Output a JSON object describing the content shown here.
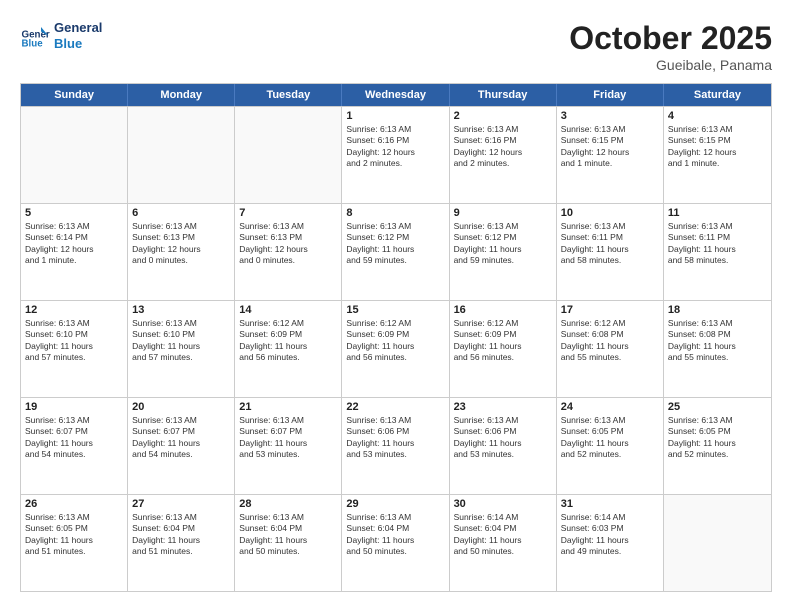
{
  "header": {
    "logo_general": "General",
    "logo_blue": "Blue",
    "month_title": "October 2025",
    "location": "Gueibale, Panama"
  },
  "weekdays": [
    "Sunday",
    "Monday",
    "Tuesday",
    "Wednesday",
    "Thursday",
    "Friday",
    "Saturday"
  ],
  "rows": [
    [
      {
        "day": "",
        "info": ""
      },
      {
        "day": "",
        "info": ""
      },
      {
        "day": "",
        "info": ""
      },
      {
        "day": "1",
        "info": "Sunrise: 6:13 AM\nSunset: 6:16 PM\nDaylight: 12 hours\nand 2 minutes."
      },
      {
        "day": "2",
        "info": "Sunrise: 6:13 AM\nSunset: 6:16 PM\nDaylight: 12 hours\nand 2 minutes."
      },
      {
        "day": "3",
        "info": "Sunrise: 6:13 AM\nSunset: 6:15 PM\nDaylight: 12 hours\nand 1 minute."
      },
      {
        "day": "4",
        "info": "Sunrise: 6:13 AM\nSunset: 6:15 PM\nDaylight: 12 hours\nand 1 minute."
      }
    ],
    [
      {
        "day": "5",
        "info": "Sunrise: 6:13 AM\nSunset: 6:14 PM\nDaylight: 12 hours\nand 1 minute."
      },
      {
        "day": "6",
        "info": "Sunrise: 6:13 AM\nSunset: 6:13 PM\nDaylight: 12 hours\nand 0 minutes."
      },
      {
        "day": "7",
        "info": "Sunrise: 6:13 AM\nSunset: 6:13 PM\nDaylight: 12 hours\nand 0 minutes."
      },
      {
        "day": "8",
        "info": "Sunrise: 6:13 AM\nSunset: 6:12 PM\nDaylight: 11 hours\nand 59 minutes."
      },
      {
        "day": "9",
        "info": "Sunrise: 6:13 AM\nSunset: 6:12 PM\nDaylight: 11 hours\nand 59 minutes."
      },
      {
        "day": "10",
        "info": "Sunrise: 6:13 AM\nSunset: 6:11 PM\nDaylight: 11 hours\nand 58 minutes."
      },
      {
        "day": "11",
        "info": "Sunrise: 6:13 AM\nSunset: 6:11 PM\nDaylight: 11 hours\nand 58 minutes."
      }
    ],
    [
      {
        "day": "12",
        "info": "Sunrise: 6:13 AM\nSunset: 6:10 PM\nDaylight: 11 hours\nand 57 minutes."
      },
      {
        "day": "13",
        "info": "Sunrise: 6:13 AM\nSunset: 6:10 PM\nDaylight: 11 hours\nand 57 minutes."
      },
      {
        "day": "14",
        "info": "Sunrise: 6:12 AM\nSunset: 6:09 PM\nDaylight: 11 hours\nand 56 minutes."
      },
      {
        "day": "15",
        "info": "Sunrise: 6:12 AM\nSunset: 6:09 PM\nDaylight: 11 hours\nand 56 minutes."
      },
      {
        "day": "16",
        "info": "Sunrise: 6:12 AM\nSunset: 6:09 PM\nDaylight: 11 hours\nand 56 minutes."
      },
      {
        "day": "17",
        "info": "Sunrise: 6:12 AM\nSunset: 6:08 PM\nDaylight: 11 hours\nand 55 minutes."
      },
      {
        "day": "18",
        "info": "Sunrise: 6:13 AM\nSunset: 6:08 PM\nDaylight: 11 hours\nand 55 minutes."
      }
    ],
    [
      {
        "day": "19",
        "info": "Sunrise: 6:13 AM\nSunset: 6:07 PM\nDaylight: 11 hours\nand 54 minutes."
      },
      {
        "day": "20",
        "info": "Sunrise: 6:13 AM\nSunset: 6:07 PM\nDaylight: 11 hours\nand 54 minutes."
      },
      {
        "day": "21",
        "info": "Sunrise: 6:13 AM\nSunset: 6:07 PM\nDaylight: 11 hours\nand 53 minutes."
      },
      {
        "day": "22",
        "info": "Sunrise: 6:13 AM\nSunset: 6:06 PM\nDaylight: 11 hours\nand 53 minutes."
      },
      {
        "day": "23",
        "info": "Sunrise: 6:13 AM\nSunset: 6:06 PM\nDaylight: 11 hours\nand 53 minutes."
      },
      {
        "day": "24",
        "info": "Sunrise: 6:13 AM\nSunset: 6:05 PM\nDaylight: 11 hours\nand 52 minutes."
      },
      {
        "day": "25",
        "info": "Sunrise: 6:13 AM\nSunset: 6:05 PM\nDaylight: 11 hours\nand 52 minutes."
      }
    ],
    [
      {
        "day": "26",
        "info": "Sunrise: 6:13 AM\nSunset: 6:05 PM\nDaylight: 11 hours\nand 51 minutes."
      },
      {
        "day": "27",
        "info": "Sunrise: 6:13 AM\nSunset: 6:04 PM\nDaylight: 11 hours\nand 51 minutes."
      },
      {
        "day": "28",
        "info": "Sunrise: 6:13 AM\nSunset: 6:04 PM\nDaylight: 11 hours\nand 50 minutes."
      },
      {
        "day": "29",
        "info": "Sunrise: 6:13 AM\nSunset: 6:04 PM\nDaylight: 11 hours\nand 50 minutes."
      },
      {
        "day": "30",
        "info": "Sunrise: 6:14 AM\nSunset: 6:04 PM\nDaylight: 11 hours\nand 50 minutes."
      },
      {
        "day": "31",
        "info": "Sunrise: 6:14 AM\nSunset: 6:03 PM\nDaylight: 11 hours\nand 49 minutes."
      },
      {
        "day": "",
        "info": ""
      }
    ]
  ]
}
